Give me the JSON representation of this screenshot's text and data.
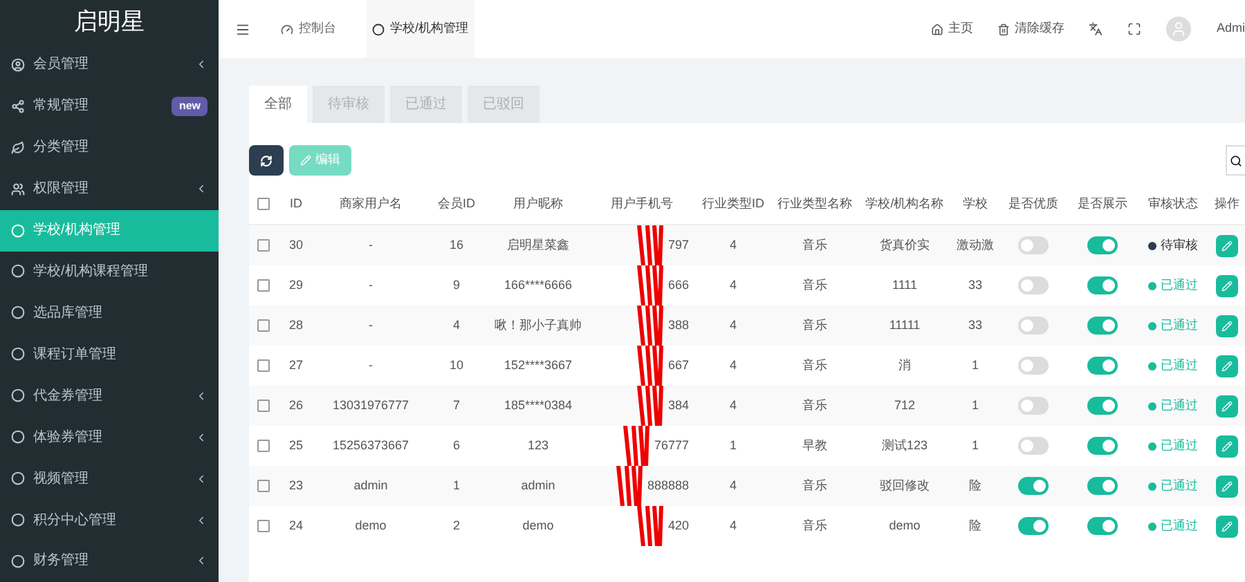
{
  "sidebar": {
    "title": "启明星",
    "items": [
      {
        "label": "会员管理",
        "arrow": true,
        "selected": false
      },
      {
        "label": "常规管理",
        "badge": "new",
        "arrow": false,
        "selected": false
      },
      {
        "label": "分类管理",
        "arrow": false,
        "selected": false
      },
      {
        "label": "权限管理",
        "arrow": true,
        "selected": false
      },
      {
        "label": "学校/机构管理",
        "arrow": false,
        "selected": true
      },
      {
        "label": "学校/机构课程管理",
        "arrow": false,
        "selected": false
      },
      {
        "label": "选品库管理",
        "arrow": false,
        "selected": false
      },
      {
        "label": "课程订单管理",
        "arrow": false,
        "selected": false
      },
      {
        "label": "代金券管理",
        "arrow": true,
        "selected": false
      },
      {
        "label": "体验券管理",
        "arrow": true,
        "selected": false
      },
      {
        "label": "视频管理",
        "arrow": true,
        "selected": false
      },
      {
        "label": "积分中心管理",
        "arrow": true,
        "selected": false
      },
      {
        "label": "财务管理",
        "arrow": true,
        "selected": false
      }
    ]
  },
  "topbar": {
    "nav_tabs": [
      {
        "label": "控制台",
        "selected": false
      },
      {
        "label": "学校/机构管理",
        "selected": true
      }
    ],
    "links": [
      {
        "label": "主页"
      },
      {
        "label": "清除缓存"
      }
    ],
    "user": "Admi"
  },
  "filter_tabs": [
    {
      "label": "全部",
      "selected": true
    },
    {
      "label": "待审核",
      "selected": false
    },
    {
      "label": "已通过",
      "selected": false
    },
    {
      "label": "已驳回",
      "selected": false
    }
  ],
  "toolbar": {
    "edit_button": "编辑"
  },
  "table": {
    "select_all_checked": false,
    "columns": [
      "ID",
      "商家用户名",
      "会员ID",
      "用户昵称",
      "用户手机号",
      "行业类型ID",
      "行业类型名称",
      "学校/机构名称",
      "学校",
      "是否优质",
      "是否展示",
      "审核状态",
      "操作"
    ],
    "rows": [
      {
        "id": "30",
        "merchant": "-",
        "member_id": "16",
        "nickname": "启明星菜鑫",
        "phone": "797",
        "industry_id": "4",
        "industry": "音乐",
        "school": "货真价实",
        "column_9": "激动激",
        "quality": false,
        "shown": true,
        "status": "待审核",
        "kind": "pending",
        "checked": false
      },
      {
        "id": "29",
        "merchant": "-",
        "member_id": "9",
        "nickname": "166****6666",
        "phone": "666",
        "industry_id": "4",
        "industry": "音乐",
        "school": "1111",
        "column_9": "33",
        "quality": false,
        "shown": true,
        "status": "已通过",
        "kind": "approved",
        "checked": false
      },
      {
        "id": "28",
        "merchant": "-",
        "member_id": "4",
        "nickname": "啾！那小子真帅",
        "phone": "388",
        "industry_id": "4",
        "industry": "音乐",
        "school": "11111",
        "column_9": "33",
        "quality": false,
        "shown": true,
        "status": "已通过",
        "kind": "approved",
        "checked": false
      },
      {
        "id": "27",
        "merchant": "-",
        "member_id": "10",
        "nickname": "152****3667",
        "phone": "667",
        "industry_id": "4",
        "industry": "音乐",
        "school": "消",
        "column_9": "1",
        "quality": false,
        "shown": true,
        "status": "已通过",
        "kind": "approved",
        "checked": false
      },
      {
        "id": "26",
        "merchant": "13031976777",
        "member_id": "7",
        "nickname": "185****0384",
        "phone": "384",
        "industry_id": "4",
        "industry": "音乐",
        "school": "712",
        "column_9": "1",
        "quality": false,
        "shown": true,
        "status": "已通过",
        "kind": "approved",
        "checked": false
      },
      {
        "id": "25",
        "merchant": "15256373667",
        "member_id": "6",
        "nickname": "123",
        "phone": "76777",
        "industry_id": "1",
        "industry": "早教",
        "school": "测试123",
        "column_9": "1",
        "quality": false,
        "shown": true,
        "status": "已通过",
        "kind": "approved",
        "checked": false
      },
      {
        "id": "23",
        "merchant": "admin",
        "member_id": "1",
        "nickname": "admin",
        "phone": "888888",
        "industry_id": "4",
        "industry": "音乐",
        "school": "驳回修改",
        "column_9": "险",
        "quality": true,
        "shown": true,
        "status": "已通过",
        "kind": "approved",
        "checked": false
      },
      {
        "id": "24",
        "merchant": "demo",
        "member_id": "2",
        "nickname": "demo",
        "phone": "420",
        "industry_id": "4",
        "industry": "音乐",
        "school": "demo",
        "column_9": "险",
        "quality": true,
        "shown": true,
        "status": "已通过",
        "kind": "approved",
        "checked": false
      }
    ]
  }
}
